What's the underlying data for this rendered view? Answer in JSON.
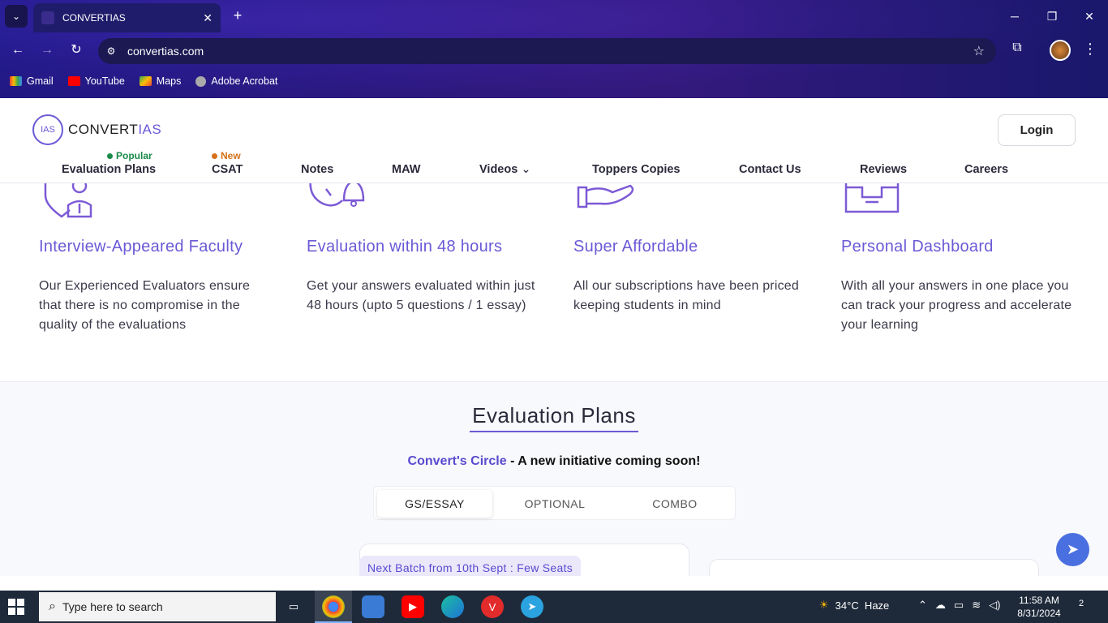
{
  "browser": {
    "tab_title": "CONVERTIAS",
    "url": "convertias.com",
    "bookmarks": [
      {
        "label": "Gmail"
      },
      {
        "label": "YouTube"
      },
      {
        "label": "Maps"
      },
      {
        "label": "Adobe Acrobat"
      }
    ]
  },
  "site": {
    "logo_prefix": "IAS",
    "logo_text_main": "CONVERT",
    "logo_text_accent": "IAS",
    "login_label": "Login",
    "menu": [
      {
        "label": "Evaluation Plans",
        "badge": "Popular"
      },
      {
        "label": "CSAT",
        "badge": "New"
      },
      {
        "label": "Notes"
      },
      {
        "label": "MAW"
      },
      {
        "label": "Videos"
      },
      {
        "label": "Toppers Copies"
      },
      {
        "label": "Contact Us"
      },
      {
        "label": "Reviews"
      },
      {
        "label": "Careers"
      }
    ]
  },
  "features": [
    {
      "title": "Interview-Appeared Faculty",
      "desc": "Our Experienced Evaluators ensure that there is no compromise in the quality of the evaluations",
      "icon": "faculty-icon"
    },
    {
      "title": "Evaluation within 48 hours",
      "desc": "Get your answers evaluated within just 48 hours (upto 5 questions / 1 essay)",
      "icon": "clock-bell-icon"
    },
    {
      "title": "Super Affordable",
      "desc": "All our subscriptions have been priced keeping students in mind",
      "icon": "hand-coin-icon"
    },
    {
      "title": "Personal Dashboard",
      "desc": "With all your answers in one place you can track your progress and accelerate your learning",
      "icon": "inbox-tray-icon"
    }
  ],
  "plans": {
    "title": "Evaluation Plans",
    "circle_name": "Convert's Circle",
    "circle_rest": " - A new initiative coming soon!",
    "tabs": [
      "GS/ESSAY",
      "OPTIONAL",
      "COMBO"
    ],
    "active_tab": "GS/ESSAY",
    "batch_label": "Next Batch from 10th Sept : Few Seats"
  },
  "taskbar": {
    "search_placeholder": "Type here to search",
    "weather": "34°C  Haze",
    "time": "11:58 AM",
    "date": "8/31/2024",
    "notifications": "2"
  },
  "colors": {
    "accent": "#6a5ad6",
    "popular_dot": "#1a8a4a",
    "new_dot": "#d4701a"
  }
}
